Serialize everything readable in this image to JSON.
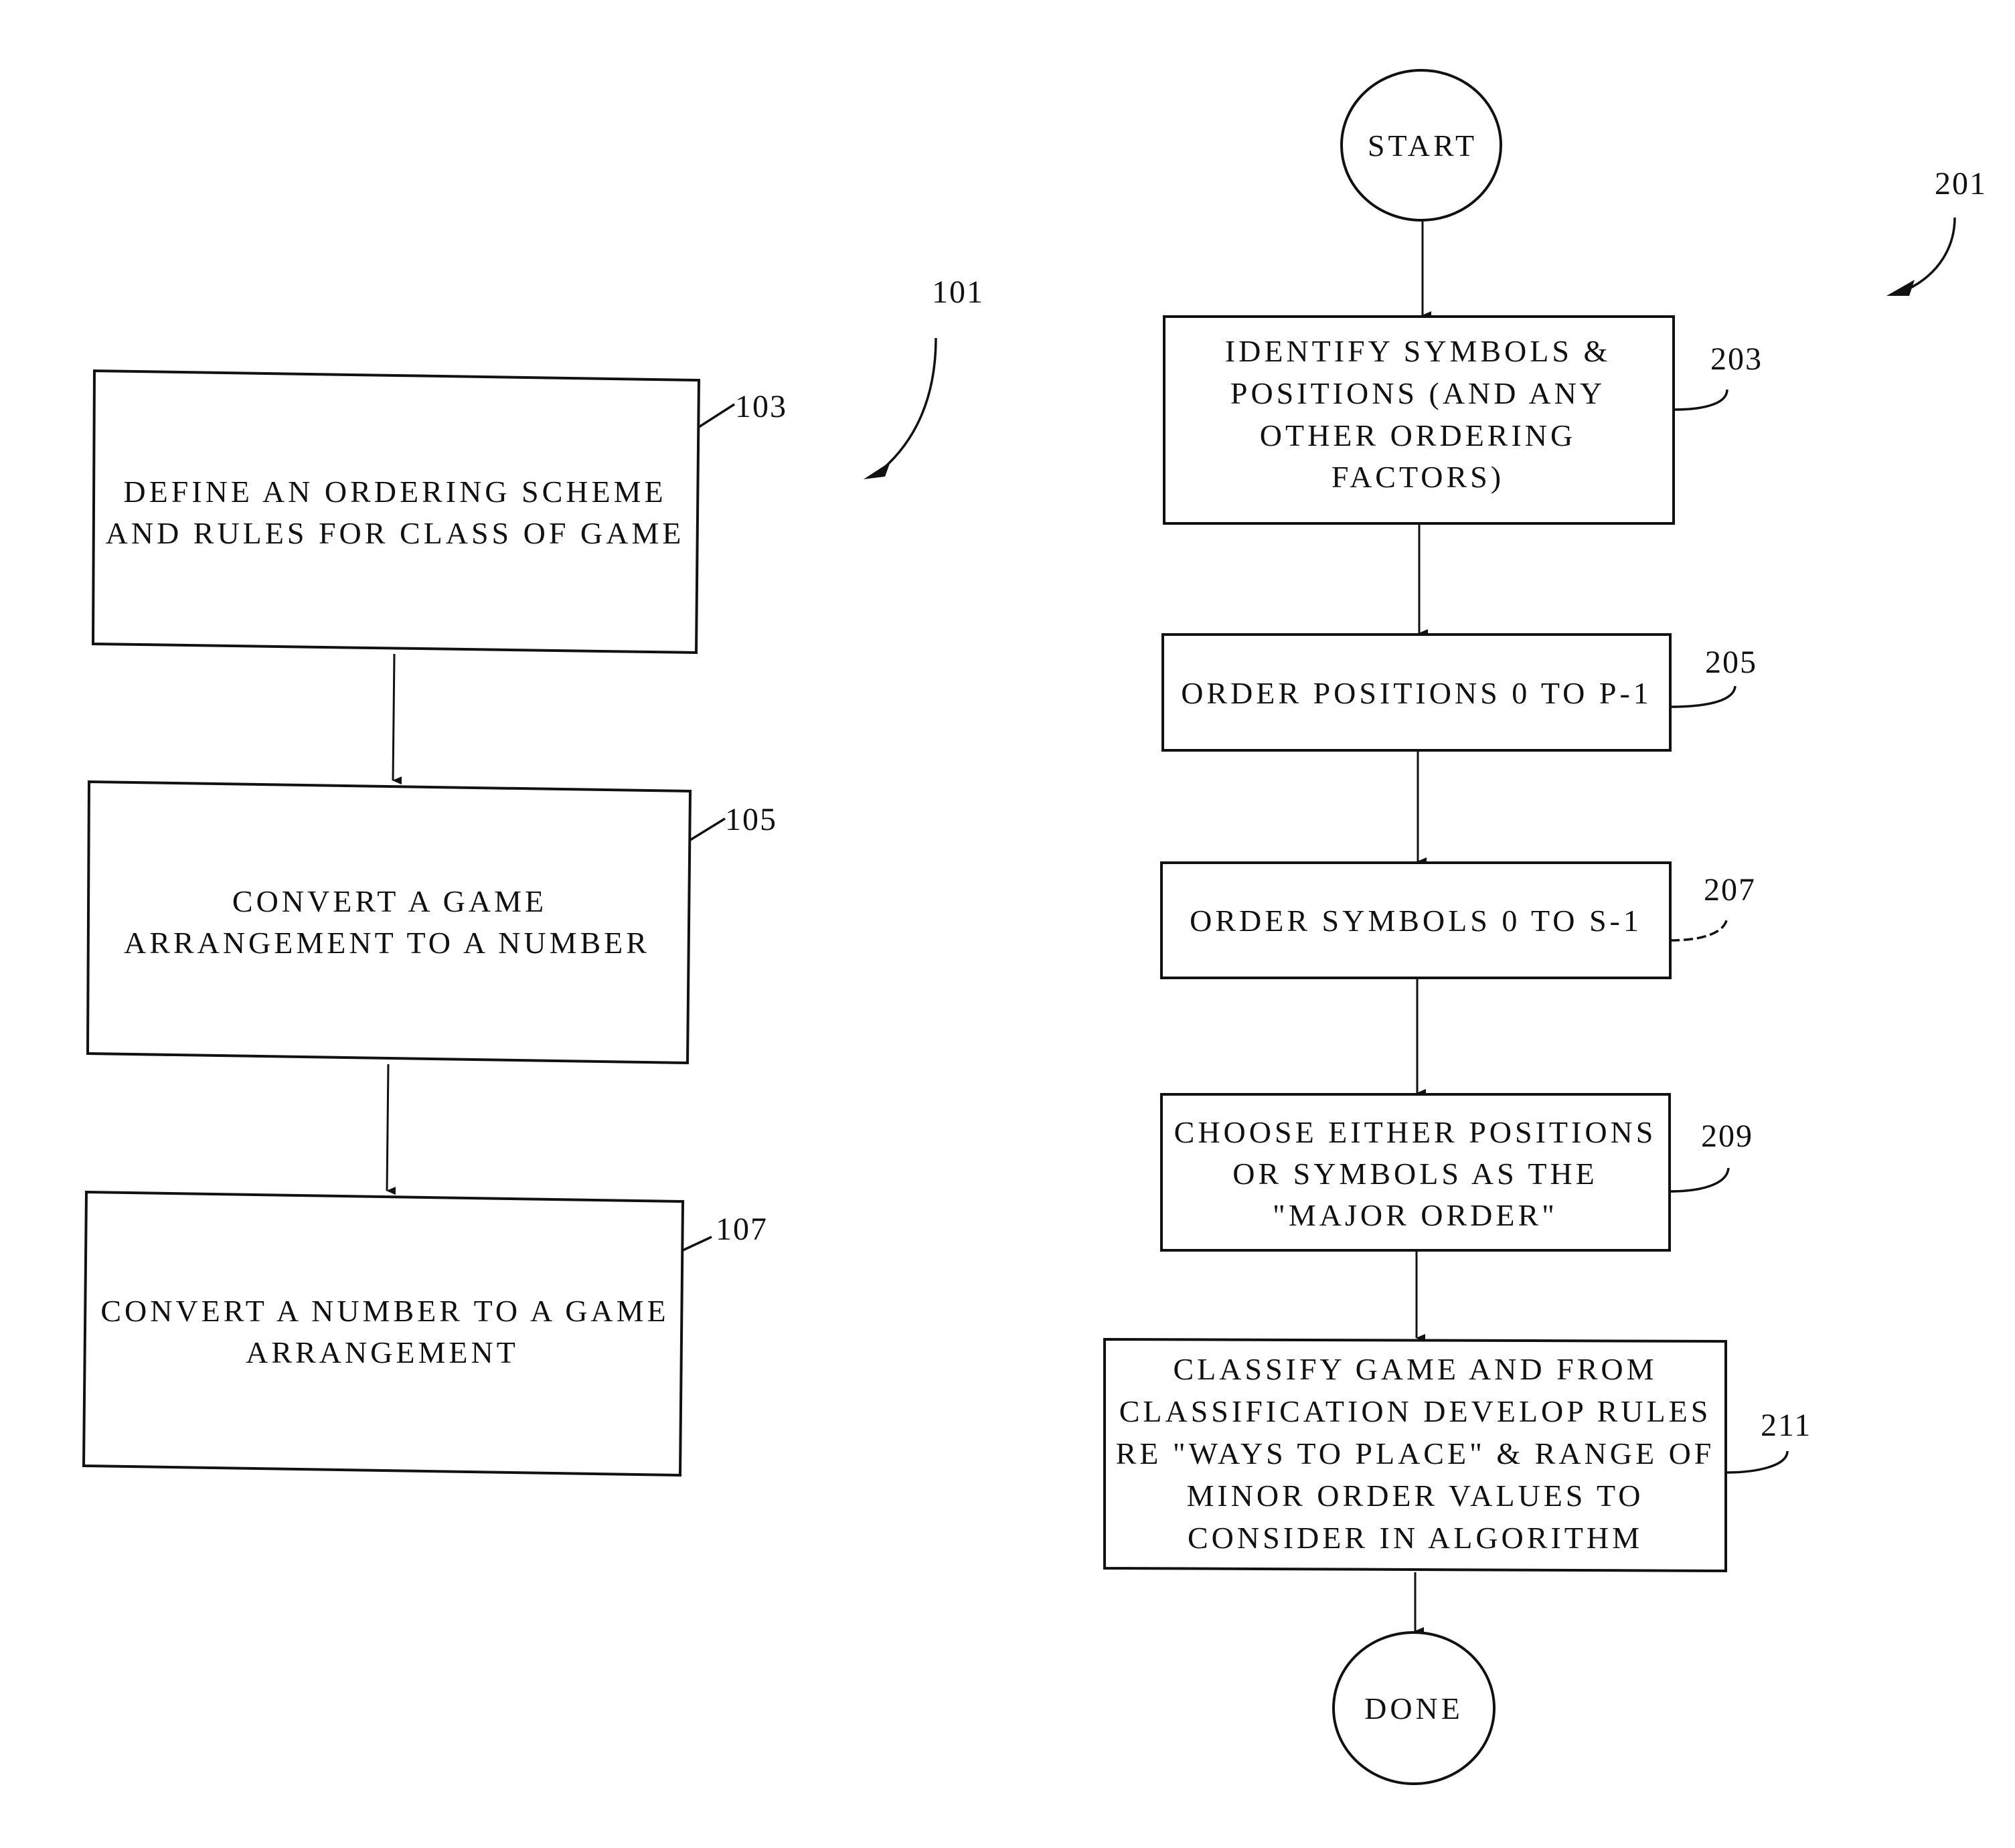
{
  "figure_left": {
    "ref": "101",
    "steps": [
      {
        "ref": "103",
        "lines": [
          "DEFINE AN ORDERING SCHEME",
          "AND RULES FOR CLASS OF GAME"
        ]
      },
      {
        "ref": "105",
        "lines": [
          "CONVERT A GAME",
          "ARRANGEMENT TO A NUMBER"
        ]
      },
      {
        "ref": "107",
        "lines": [
          "CONVERT A NUMBER TO A GAME",
          "ARRANGEMENT"
        ]
      }
    ]
  },
  "figure_right": {
    "ref": "201",
    "start_label": "START",
    "done_label": "DONE",
    "steps": [
      {
        "ref": "203",
        "lines": [
          "IDENTIFY SYMBOLS &",
          "POSITIONS (AND ANY",
          "OTHER ORDERING",
          "FACTORS)"
        ]
      },
      {
        "ref": "205",
        "lines": [
          "ORDER POSITIONS 0 TO P-1"
        ]
      },
      {
        "ref": "207",
        "lines": [
          "ORDER SYMBOLS 0 TO S-1"
        ]
      },
      {
        "ref": "209",
        "lines": [
          "CHOOSE EITHER POSITIONS",
          "OR SYMBOLS AS THE",
          "\"MAJOR ORDER\""
        ]
      },
      {
        "ref": "211",
        "lines": [
          "CLASSIFY GAME AND FROM",
          "CLASSIFICATION DEVELOP RULES",
          "RE \"WAYS TO PLACE\" & RANGE OF",
          "MINOR ORDER VALUES TO",
          "CONSIDER IN ALGORITHM"
        ]
      }
    ]
  }
}
